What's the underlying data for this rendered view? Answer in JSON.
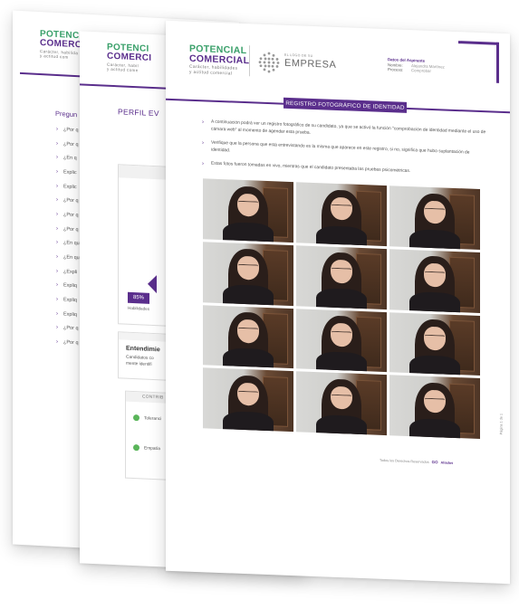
{
  "brand": {
    "line1": "POTENCIAL",
    "line2": "COMERCIAL",
    "tagline_front_1": "Carácter, habilidades",
    "tagline_front_2": "y actitud comercial",
    "tagline_back1": "Carácter, habilida",
    "tagline_back1_b": "y actitud com",
    "tagline_back2_1": "Carácter, habil",
    "tagline_back2_2": "y actitud come",
    "back1_line1": "POTENC",
    "back1_line2": "COMERC",
    "back2_line1": "POTENCI",
    "back2_line2": "COMERCI"
  },
  "company_logo": {
    "small_text": "EL LOGO DE SU",
    "big_text": "EMPRESA"
  },
  "applicant": {
    "heading": "Datos del Aspirante",
    "name_label": "Nombre:",
    "name_value": "Alejandra Martínez",
    "process_label": "Proceso:",
    "process_value": "Comprobar"
  },
  "back_page1": {
    "heading": "Pregun",
    "questions": [
      "¿Por q",
      "¿Por q",
      "¿En q",
      "Explic",
      "Explic",
      "¿Por q",
      "¿Por q",
      "¿Por q",
      "¿En qu",
      "¿En qu",
      "¿Expli",
      "Expliq",
      "Expliq",
      "Expliq",
      "¿Por q",
      "¿Por q"
    ]
  },
  "back_page2": {
    "heading": "PERFIL EV",
    "percent": "85%",
    "percent_label": "Habilidades",
    "understanding_title": "Entendimie",
    "understanding_line1": "Candidatos co",
    "understanding_line2": "mente identifi",
    "contrib_header": "CONTRIB",
    "contrib_items": [
      "Toleranci",
      "Empatía"
    ]
  },
  "front_page": {
    "banner": "REGISTRO FOTOGRÁFICO DE IDENTIDAD",
    "bullet1": "A continuación podrá ver un registro fotográfico de su candidato, ya que se activó la función \"comprobación de identidad mediante el uso de cámara web\" al momento de agendar esta prueba.",
    "bullet2": "Verifique que la persona que está entrevistando es la misma que aparece en este registro, si no, significa que hubo suplantación de identidad.",
    "bullet3": "Estas fotos fueron tomadas en vivo, mientras que el candidato presentaba las pruebas psicométricas.",
    "footer_left": "Todos los Derechos Reservados",
    "footer_right": "Aliados",
    "footer_brand": "GO",
    "page_label": "Página 1 de 1"
  },
  "colors": {
    "purple": "#5a2e8c",
    "green": "#3aa06a"
  }
}
